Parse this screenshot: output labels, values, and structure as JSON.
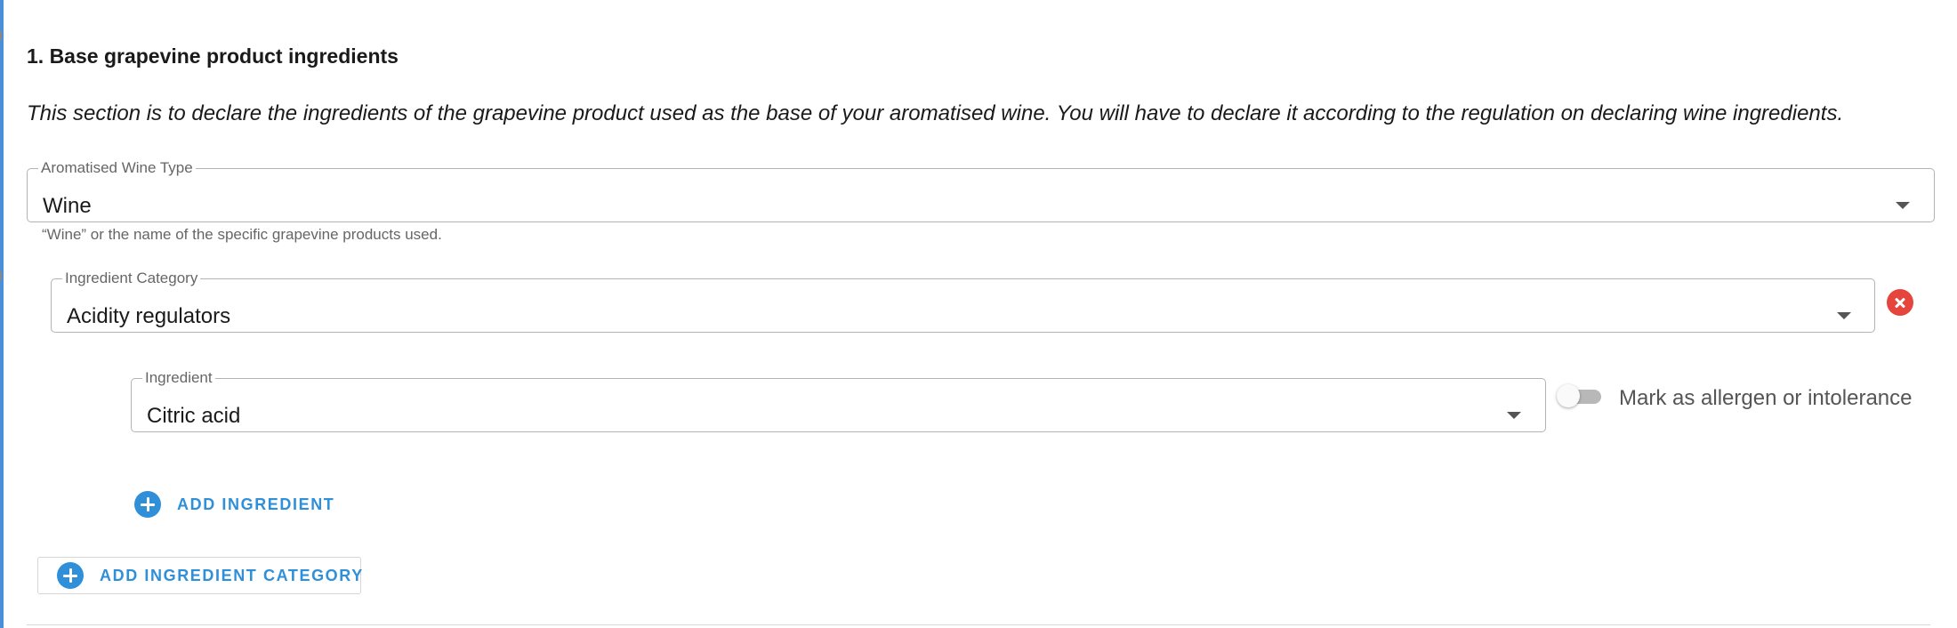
{
  "section": {
    "title": "1. Base grapevine product ingredients",
    "description": "This section is to declare the ingredients of the grapevine product used as the base of your aromatised wine. You will have to declare it according to the regulation on declaring wine ingredients."
  },
  "wine_type": {
    "label": "Aromatised Wine Type",
    "value": "Wine",
    "helper": "“Wine” or the name of the specific grapevine products used.",
    "icon": "caret-down-icon"
  },
  "ingredient_category": {
    "label": "Ingredient Category",
    "value": "Acidity regulators",
    "remove_icon": "remove-circle-icon",
    "remove_color": "#e5453d"
  },
  "ingredient": {
    "label": "Ingredient",
    "value": "Citric acid",
    "allergen_toggle": {
      "label": "Mark as allergen or intolerance",
      "checked": false
    }
  },
  "actions": {
    "add_ingredient": "ADD INGREDIENT",
    "add_ingredient_category": "ADD INGREDIENT CATEGORY",
    "accent_color": "#2f8fd8",
    "icon": "plus-circle-icon"
  }
}
